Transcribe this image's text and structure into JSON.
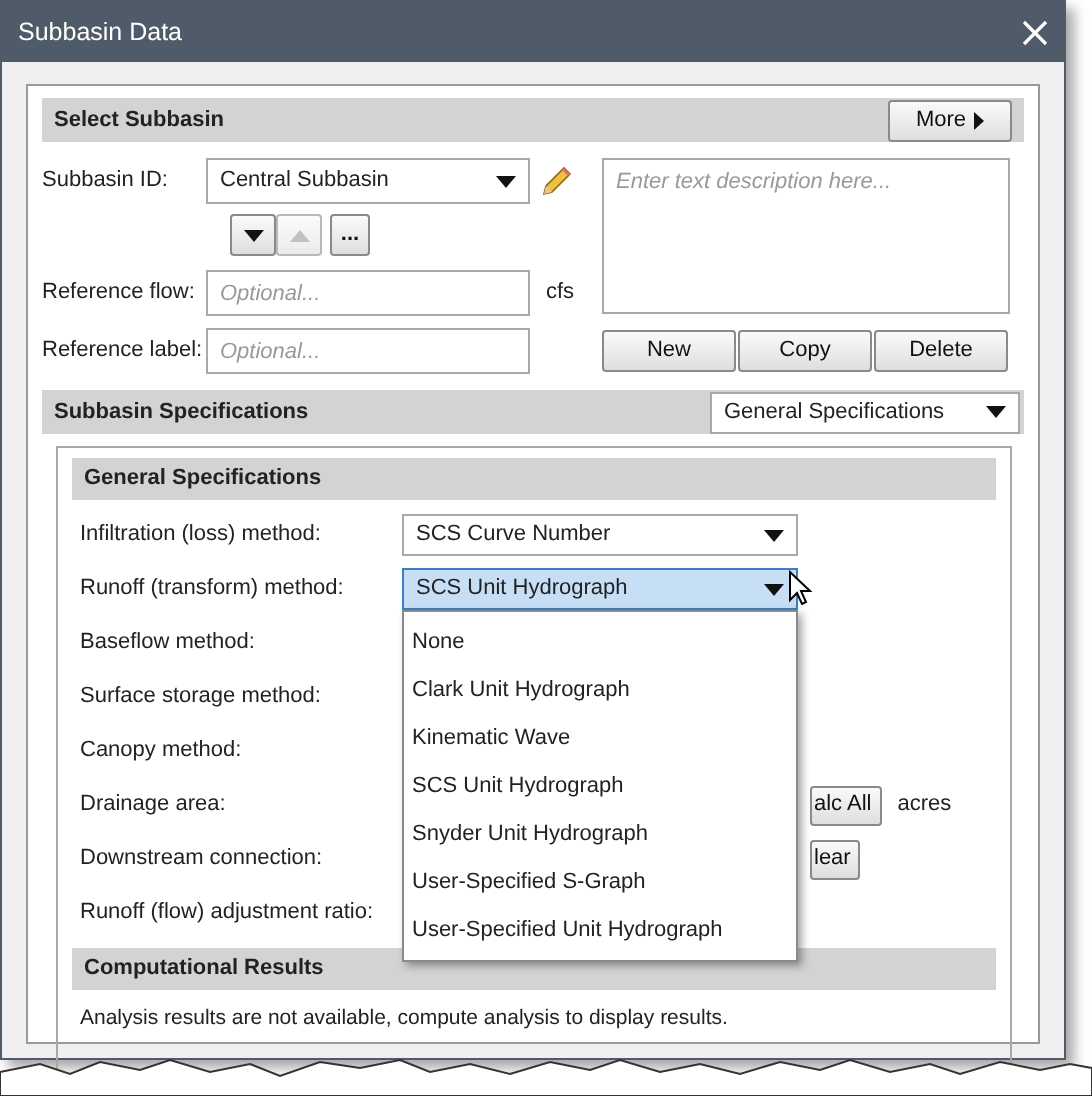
{
  "window": {
    "title": "Subbasin Data"
  },
  "select_subbasin": {
    "title": "Select Subbasin",
    "more_button": "More",
    "subbasin_id": {
      "label": "Subbasin ID:",
      "value": "Central Subbasin"
    },
    "browse_button": "...",
    "description": {
      "placeholder": "Enter text description here..."
    },
    "reference_flow": {
      "label": "Reference flow:",
      "placeholder": "Optional...",
      "unit": "cfs"
    },
    "reference_label": {
      "label": "Reference label:",
      "placeholder": "Optional..."
    },
    "buttons": [
      "New",
      "Copy",
      "Delete"
    ]
  },
  "subbasin_specifications": {
    "title": "Subbasin Specifications",
    "view": "General Specifications",
    "section_title": "General Specifications",
    "rows": [
      {
        "kind": "dropdown",
        "label": "Infiltration (loss) method:",
        "value": "SCS Curve Number",
        "focused": false
      },
      {
        "kind": "dropdown",
        "label": "Runoff (transform) method:",
        "value": "SCS Unit Hydrograph",
        "focused": true,
        "open": true,
        "options": [
          "None",
          "Clark Unit Hydrograph",
          "Kinematic Wave",
          "SCS Unit Hydrograph",
          "Snyder Unit Hydrograph",
          "User-Specified S-Graph",
          "User-Specified Unit Hydrograph"
        ]
      },
      {
        "kind": "plain",
        "label": "Baseflow method:"
      },
      {
        "kind": "plain",
        "label": "Surface storage method:"
      },
      {
        "kind": "plain",
        "label": "Canopy method:"
      },
      {
        "kind": "button",
        "label": "Drainage area:",
        "button": "alc All",
        "unit": "acres"
      },
      {
        "kind": "button",
        "label": "Downstream connection:",
        "button": "lear"
      },
      {
        "kind": "plain",
        "label": "Runoff (flow) adjustment ratio:"
      }
    ]
  },
  "computational_results": {
    "title": "Computational Results",
    "message": "Analysis results are not available, compute analysis to display results."
  }
}
